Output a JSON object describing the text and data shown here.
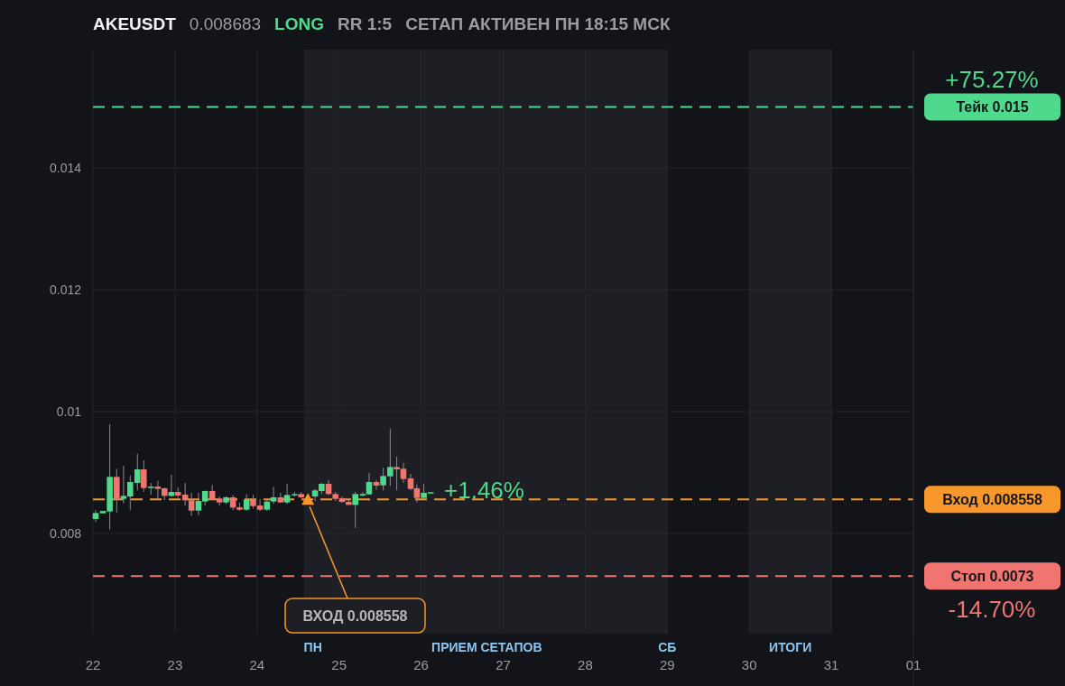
{
  "header": {
    "symbol": "AKEUSDT",
    "price": "0.008683",
    "side": "LONG",
    "risk_reward": "RR 1:5",
    "status": "СЕТАП АКТИВЕН ПН 18:15 МСК"
  },
  "chart": {
    "chart_data": {
      "type": "candlestick",
      "grid": true,
      "xlim": [
        22,
        32
      ],
      "ylim": [
        0.006356,
        0.01594
      ],
      "xticks": [
        {
          "value": 22,
          "label": "22"
        },
        {
          "value": 23,
          "label": "23"
        },
        {
          "value": 24,
          "label": "24"
        },
        {
          "value": 25,
          "label": "25"
        },
        {
          "value": 26,
          "label": "26"
        },
        {
          "value": 27,
          "label": "27"
        },
        {
          "value": 28,
          "label": "28"
        },
        {
          "value": 29,
          "label": "29"
        },
        {
          "value": 30,
          "label": "30"
        },
        {
          "value": 31,
          "label": "31"
        }
      ],
      "yticks": [
        {
          "value": 0.008,
          "label": "0.008"
        },
        {
          "value": 0.01,
          "label": "0.01"
        },
        {
          "value": 0.012,
          "label": "0.012"
        },
        {
          "value": 0.014,
          "label": "0.014"
        }
      ],
      "x": [
        22.033,
        22.121,
        22.205,
        22.289,
        22.373,
        22.454,
        22.542,
        22.619,
        22.707,
        22.791,
        22.872,
        22.956,
        23.036,
        23.124,
        23.201,
        23.286,
        23.366,
        23.454,
        23.542,
        23.623,
        23.707,
        23.787,
        23.872,
        23.952,
        24.036,
        24.121,
        24.201,
        24.286,
        24.366,
        24.458,
        24.538,
        24.707,
        24.787,
        24.872,
        24.956,
        25.036,
        25.117,
        25.198,
        25.289,
        25.366,
        25.454,
        25.538,
        25.623,
        25.703,
        25.784,
        25.872,
        25.948,
        26.033,
        26.117
      ],
      "ohlc": [
        [
          0.008237,
          0.008385,
          0.008188,
          0.008336
        ],
        [
          0.008331,
          0.00837,
          0.008331,
          0.00837
        ],
        [
          0.008361,
          0.009793,
          0.008064,
          0.008928
        ],
        [
          0.008928,
          0.009062,
          0.008346,
          0.008568
        ],
        [
          0.008568,
          0.009111,
          0.008494,
          0.008617
        ],
        [
          0.008607,
          0.008953,
          0.008385,
          0.008844
        ],
        [
          0.00883,
          0.009309,
          0.008706,
          0.009052
        ],
        [
          0.009052,
          0.0092,
          0.008681,
          0.008746
        ],
        [
          0.008746,
          0.00883,
          0.008632,
          0.00877
        ],
        [
          0.00877,
          0.008864,
          0.008558,
          0.008731
        ],
        [
          0.008741,
          0.008756,
          0.008548,
          0.008617
        ],
        [
          0.008617,
          0.008963,
          0.008598,
          0.008681
        ],
        [
          0.008681,
          0.008756,
          0.008583,
          0.008622
        ],
        [
          0.008637,
          0.00883,
          0.008459,
          0.008543
        ],
        [
          0.008543,
          0.008667,
          0.008286,
          0.008375
        ],
        [
          0.008375,
          0.008667,
          0.008301,
          0.008533
        ],
        [
          0.008524,
          0.008706,
          0.008459,
          0.008696
        ],
        [
          0.008696,
          0.008795,
          0.008548,
          0.008558
        ],
        [
          0.008573,
          0.008607,
          0.008459,
          0.008509
        ],
        [
          0.008509,
          0.008607,
          0.008484,
          0.008593
        ],
        [
          0.008593,
          0.008632,
          0.008385,
          0.008425
        ],
        [
          0.00843,
          0.008509,
          0.00837,
          0.00839
        ],
        [
          0.00839,
          0.008647,
          0.00837,
          0.008558
        ],
        [
          0.008558,
          0.008632,
          0.00841,
          0.008449
        ],
        [
          0.008459,
          0.008558,
          0.00837,
          0.00839
        ],
        [
          0.00839,
          0.008583,
          0.00837,
          0.008524
        ],
        [
          0.008524,
          0.008765,
          0.008484,
          0.008593
        ],
        [
          0.008593,
          0.008667,
          0.008509,
          0.008509
        ],
        [
          0.008509,
          0.008815,
          0.008484,
          0.008632
        ],
        [
          0.008627,
          0.008681,
          0.008607,
          0.008647
        ],
        [
          0.008647,
          0.008681,
          0.008583,
          0.008593
        ],
        [
          0.008607,
          0.008731,
          0.008533,
          0.008706
        ],
        [
          0.008696,
          0.00883,
          0.008647,
          0.008815
        ],
        [
          0.008815,
          0.008879,
          0.008632,
          0.008647
        ],
        [
          0.008647,
          0.008681,
          0.008533,
          0.008568
        ],
        [
          0.008578,
          0.008607,
          0.008499,
          0.008519
        ],
        [
          0.008519,
          0.008548,
          0.008469,
          0.008469
        ],
        [
          0.008469,
          0.008681,
          0.008089,
          0.008647
        ],
        [
          0.008622,
          0.008681,
          0.008607,
          0.008647
        ],
        [
          0.008642,
          0.008993,
          0.008632,
          0.008844
        ],
        [
          0.008844,
          0.008879,
          0.008716,
          0.008785
        ],
        [
          0.00879,
          0.009077,
          0.008706,
          0.008943
        ],
        [
          0.008938,
          0.009718,
          0.00878,
          0.009091
        ],
        [
          0.009091,
          0.009259,
          0.008706,
          0.009052
        ],
        [
          0.009062,
          0.00916,
          0.00883,
          0.008894
        ],
        [
          0.008904,
          0.008978,
          0.008706,
          0.008731
        ],
        [
          0.008741,
          0.008805,
          0.008509,
          0.008583
        ],
        [
          0.008583,
          0.008815,
          0.008583,
          0.008667
        ],
        [
          0.008657,
          0.008677,
          0.008657,
          0.008677
        ]
      ],
      "bands": [
        {
          "axis": "x",
          "from": 24.57,
          "to": 29
        },
        {
          "axis": "x",
          "from": 30,
          "to": 31
        }
      ],
      "ref_lines": [
        {
          "axis": "y",
          "value": 0.015,
          "color": "#4fd98c"
        },
        {
          "axis": "y",
          "value": 0.008558,
          "color": "#f8982b"
        },
        {
          "axis": "y",
          "value": 0.0073,
          "color": "#f07570"
        }
      ],
      "annotations": [
        {
          "x": 24.62,
          "y": 0.008558,
          "text": "ВХОД 0.008558"
        },
        {
          "x": 26.28,
          "y": 0.008558,
          "text": "+1.46%"
        }
      ]
    },
    "month_start_tick": {
      "label": "01"
    },
    "sessions": [
      {
        "label": "ПН"
      },
      {
        "label": "ПРИЕМ СЕТАПОВ"
      },
      {
        "label": "СБ"
      },
      {
        "label": "ИТОГИ"
      }
    ],
    "price_labels": [
      {
        "kind": "take",
        "label": "Тейк 0.015",
        "change": "+75.27%"
      },
      {
        "kind": "entry",
        "label": "Вход 0.008558"
      },
      {
        "kind": "stop",
        "label": "Стоп 0.0073",
        "change": "-14.70%"
      }
    ]
  }
}
